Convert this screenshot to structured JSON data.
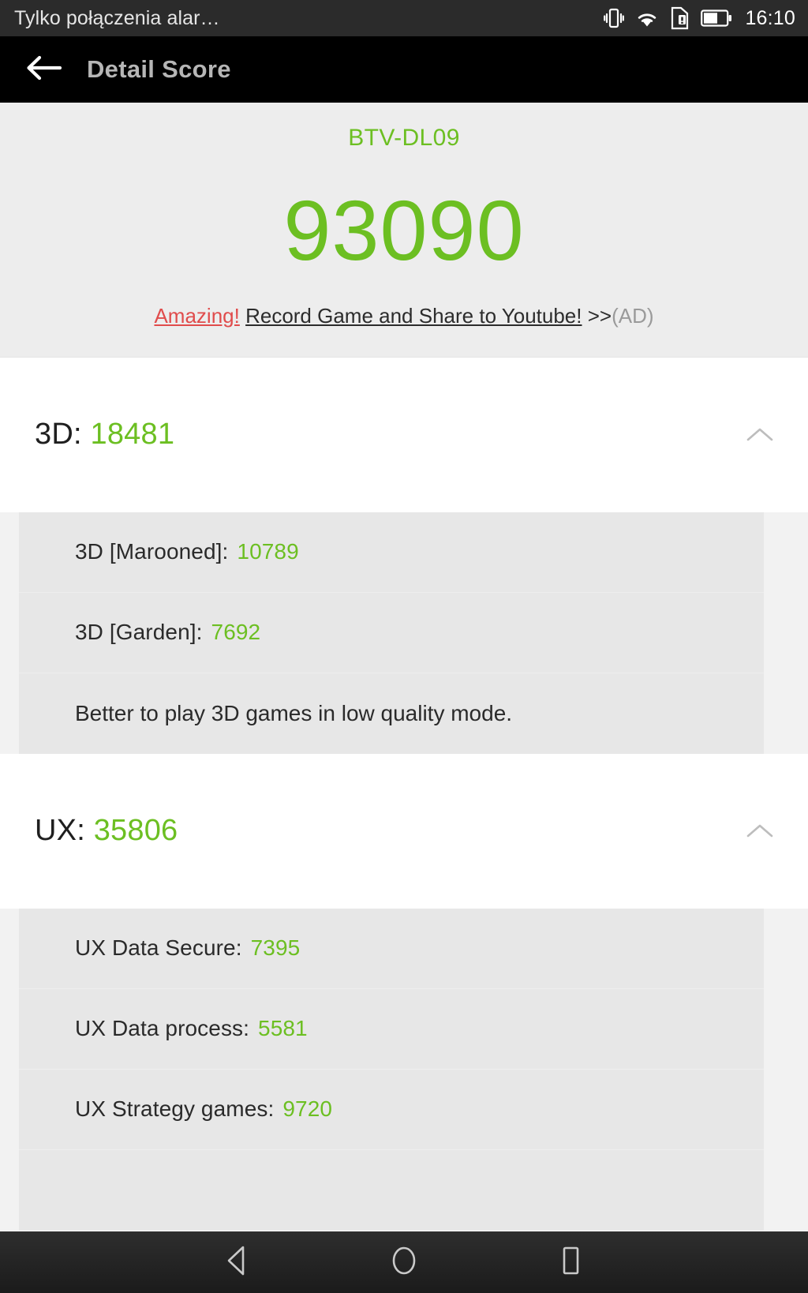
{
  "status_bar": {
    "carrier": "Tylko połączenia alar…",
    "time": "16:10",
    "icons": [
      "vibrate-icon",
      "wifi-icon",
      "sim-card-alert-icon",
      "battery-icon"
    ]
  },
  "action_bar": {
    "back_icon": "back-arrow-icon",
    "title": "Detail Score"
  },
  "summary": {
    "device_name": "BTV-DL09",
    "total_score": "93090",
    "ad": {
      "highlight": "Amazing!",
      "text": "Record Game and Share to Youtube!",
      "arrows": ">>",
      "tag": "(AD)"
    }
  },
  "sections": [
    {
      "name": "3D",
      "label": "3D:",
      "score": "18481",
      "expanded": true,
      "chevron": "chevron-up-icon",
      "items": [
        {
          "label": "3D [Marooned]:",
          "value": "10789"
        },
        {
          "label": "3D [Garden]:",
          "value": "7692"
        }
      ],
      "note": "Better to play 3D games in low quality mode."
    },
    {
      "name": "UX",
      "label": "UX:",
      "score": "35806",
      "expanded": true,
      "chevron": "chevron-up-icon",
      "items": [
        {
          "label": "UX Data Secure:",
          "value": "7395"
        },
        {
          "label": "UX Data process:",
          "value": "5581"
        },
        {
          "label": "UX Strategy games:",
          "value": "9720"
        }
      ],
      "note": ""
    }
  ],
  "nav_bar": {
    "back": "nav-back-icon",
    "home": "nav-home-icon",
    "recents": "nav-recents-icon"
  },
  "colors": {
    "accent_green": "#6cbf22",
    "ad_red": "#e04c4c",
    "panel_bg": "#ededed",
    "row_bg": "#e7e7e7"
  }
}
